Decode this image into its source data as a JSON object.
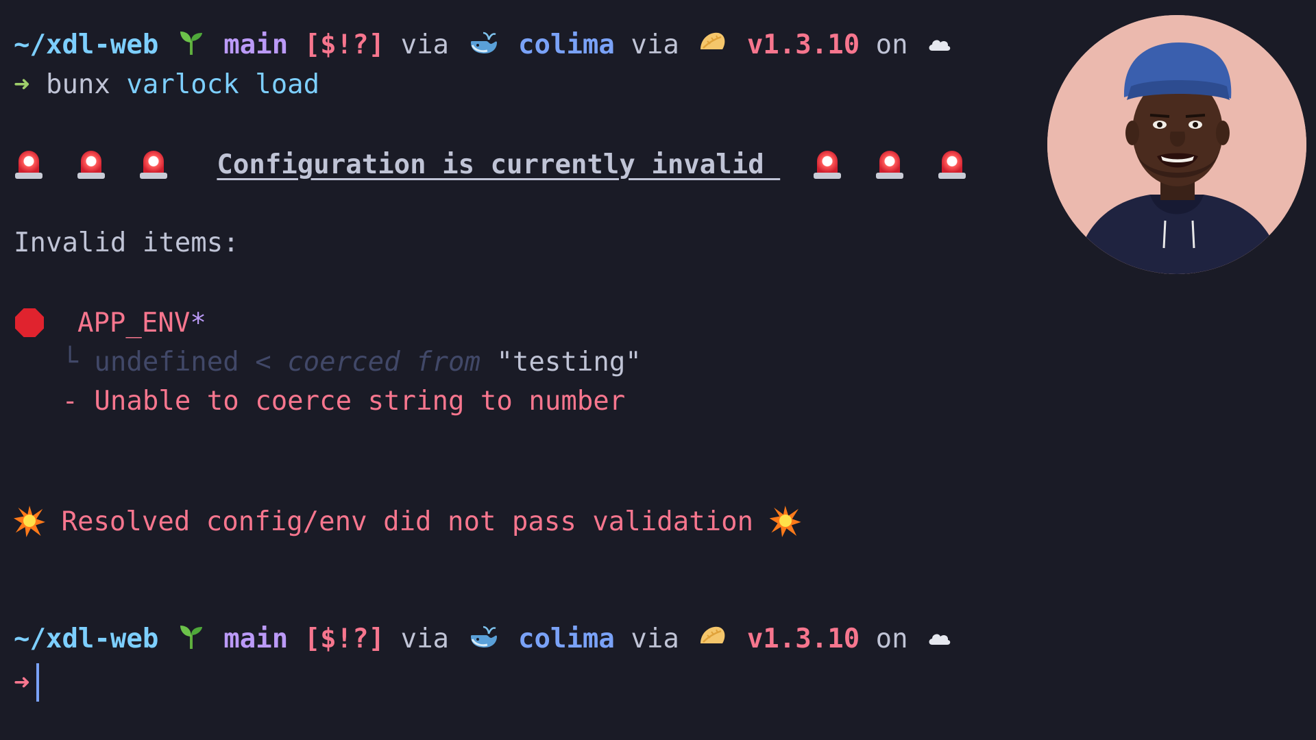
{
  "prompt1": {
    "dir": "~/xdl-web",
    "branch": "main",
    "git_status": "[$!?]",
    "via1": "via",
    "docker_context": "colima",
    "via2": "via",
    "version": "v1.3.10",
    "on": "on",
    "icons": [
      "seedling-icon",
      "whale-icon",
      "dumpling-icon",
      "cloud-icon"
    ]
  },
  "command": {
    "arrow": "➜",
    "exec": "bunx",
    "args": "varlock load"
  },
  "output": {
    "heading": "Configuration is currently invalid ",
    "invalid_items_label": "Invalid items:",
    "item": {
      "key": "APP_ENV",
      "required_marker": "*",
      "tree_branch": "└",
      "resolved": "undefined",
      "lt": "<",
      "coerced_label": "coerced from",
      "original_value": "\"testing\"",
      "error": "- Unable to coerce string to number"
    },
    "summary": "Resolved config/env did not pass validation"
  },
  "prompt2": {
    "dir": "~/xdl-web",
    "branch": "main",
    "git_status": "[$!?]",
    "via1": "via",
    "docker_context": "colima",
    "via2": "via",
    "version": "v1.3.10",
    "on": "on",
    "arrow": "➜"
  },
  "colors": {
    "background": "#1a1b26",
    "cyan": "#7dcfff",
    "purple": "#bb9af7",
    "pink": "#f7768e",
    "blue": "#7aa2f7",
    "green": "#9ece6a",
    "dim": "#414868"
  }
}
